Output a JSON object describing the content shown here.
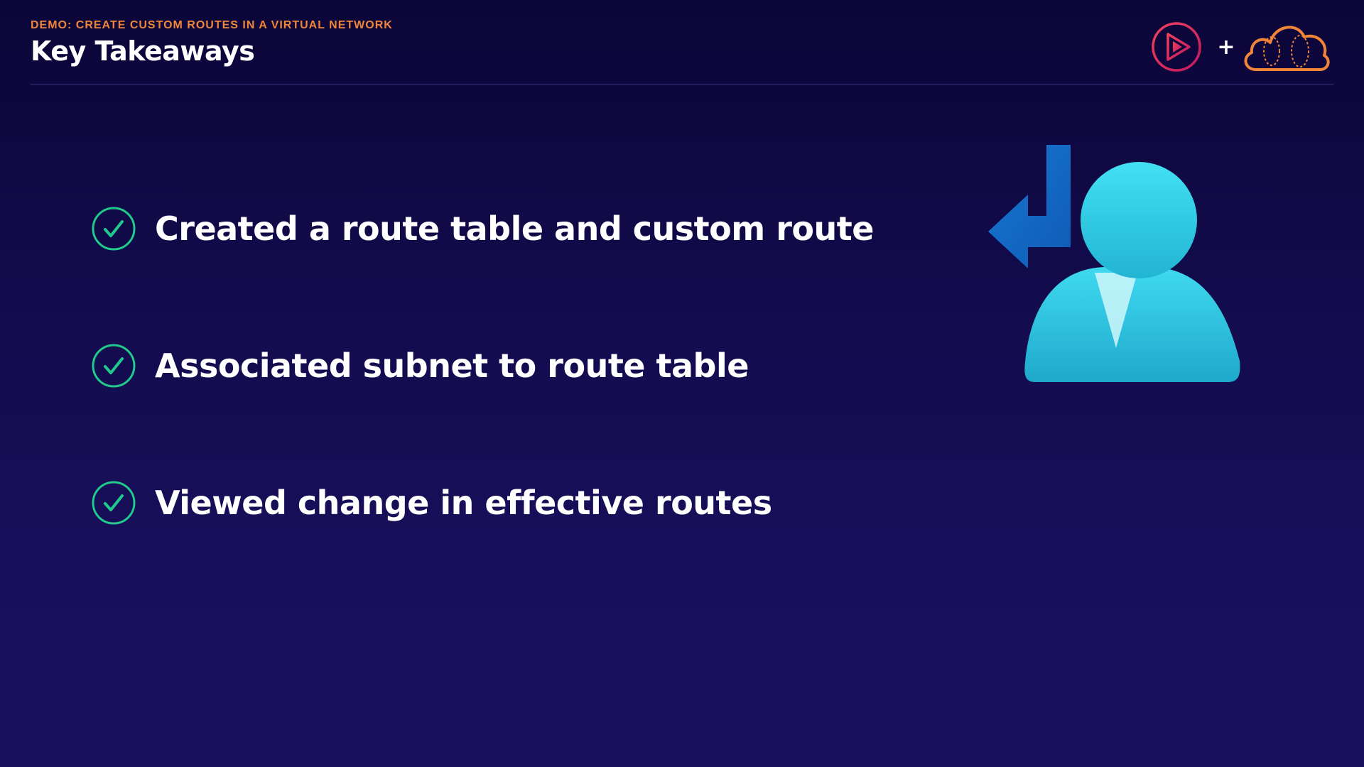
{
  "header": {
    "eyebrow": "DEMO: CREATE CUSTOM ROUTES IN A VIRTUAL NETWORK",
    "title": "Key Takeaways"
  },
  "brand": {
    "plus": "+",
    "logos": [
      "pluralsight-play-icon",
      "cloud-academy-cloud-icon"
    ]
  },
  "takeaways": [
    {
      "icon": "check-circle-icon",
      "text": "Created a route table and custom route"
    },
    {
      "icon": "check-circle-icon",
      "text": "Associated subnet to route table"
    },
    {
      "icon": "check-circle-icon",
      "text": "Viewed change in effective routes"
    }
  ],
  "illustration": {
    "icon": "user-with-route-arrow-icon"
  },
  "colors": {
    "accent_orange": "#f0853a",
    "check_green": "#21c98c",
    "arrow_blue": "#1569c7",
    "user_cyan": "#3ad7ee",
    "brand_pink": "#e6245c"
  }
}
